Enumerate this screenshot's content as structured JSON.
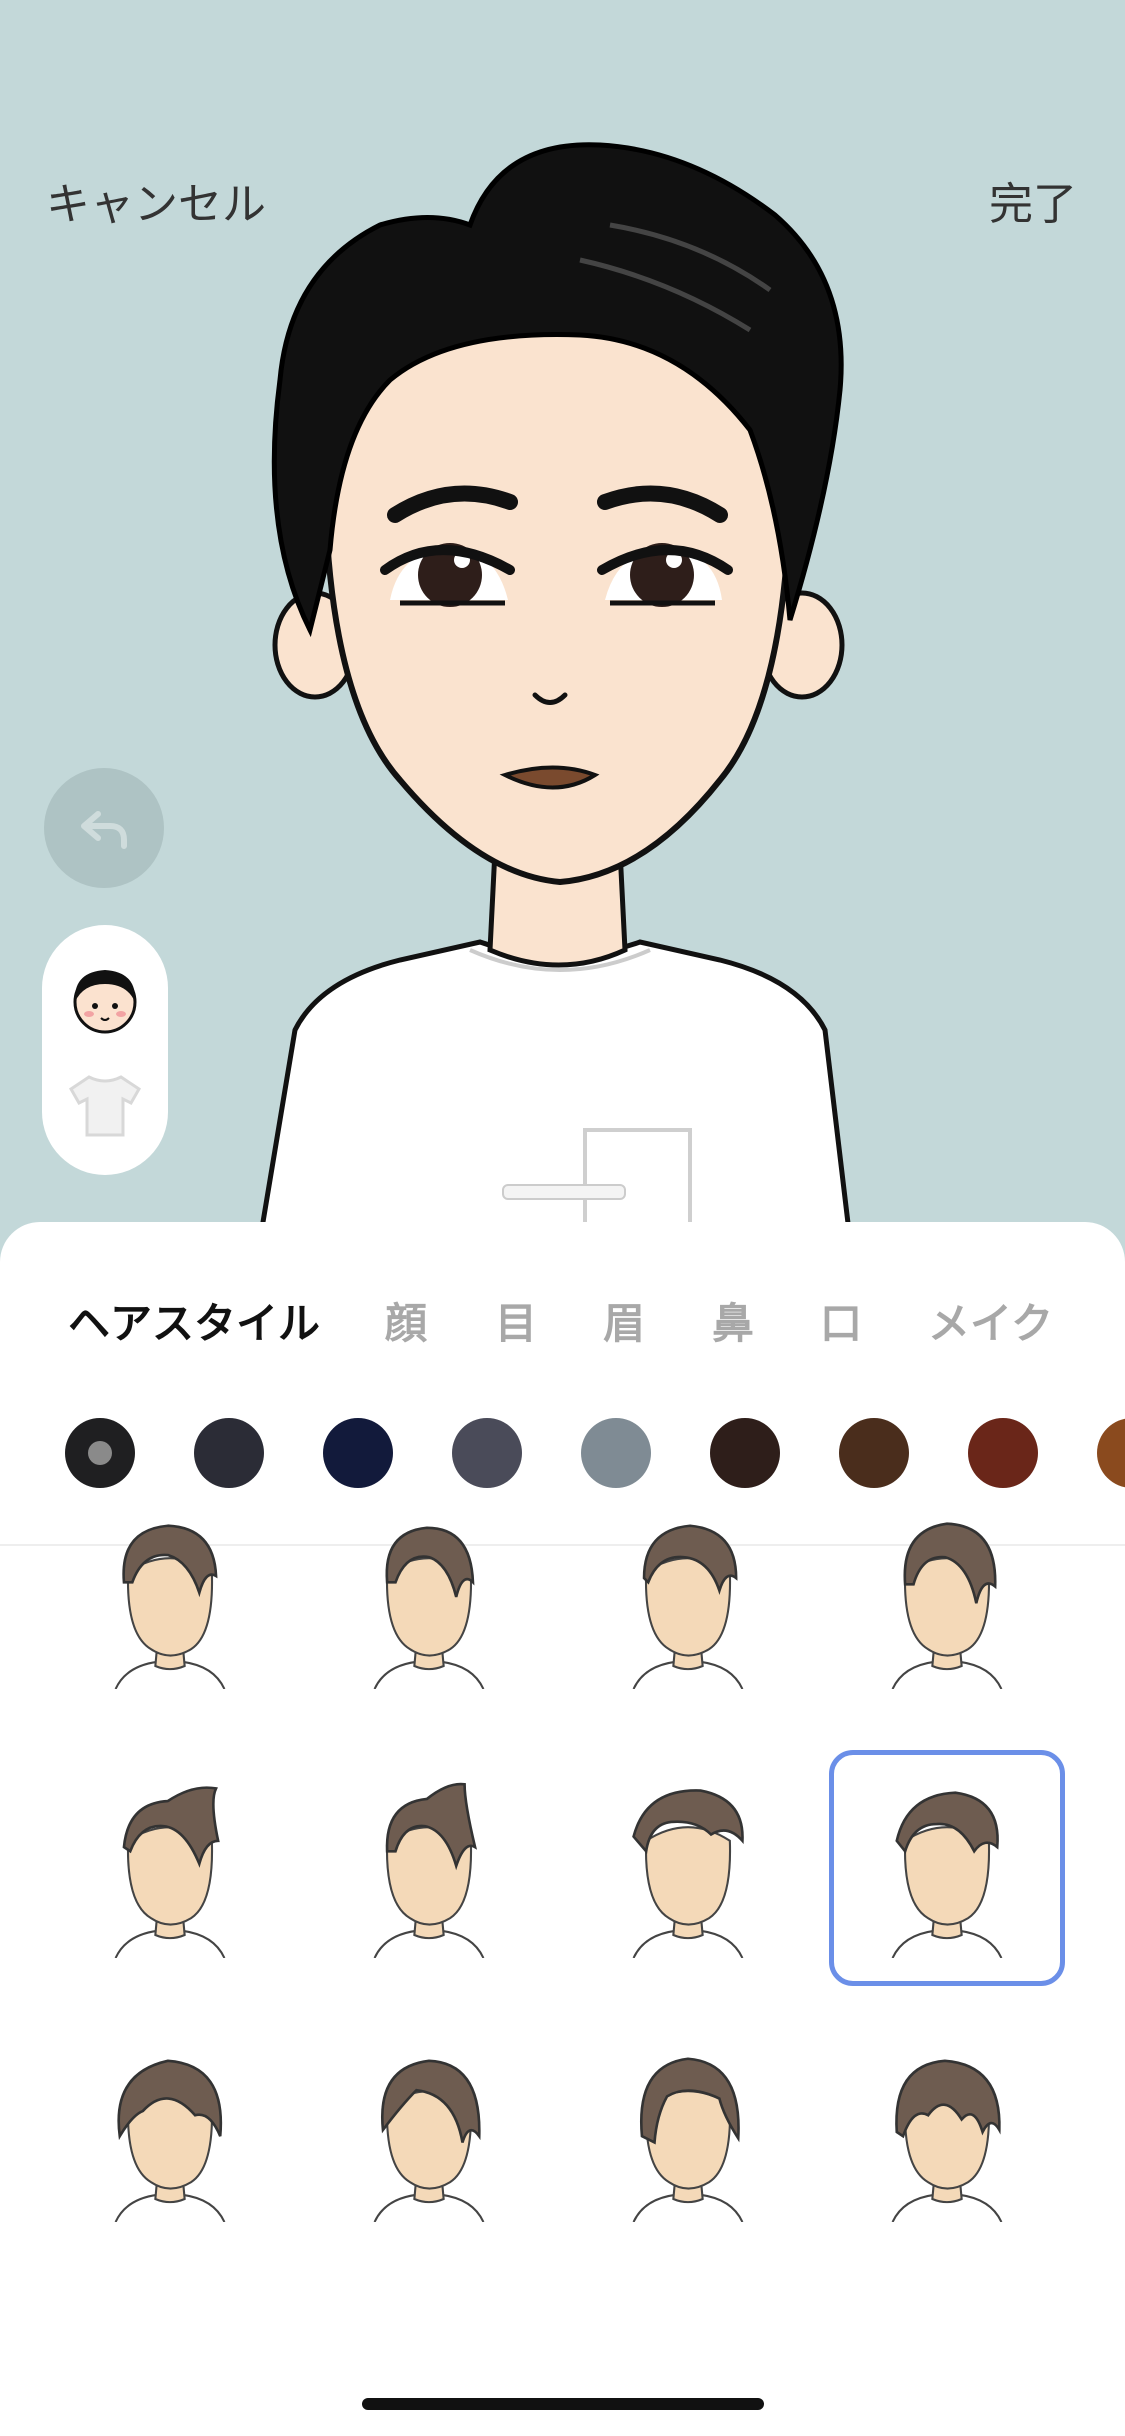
{
  "header": {
    "cancel_label": "キャンセル",
    "done_label": "完了"
  },
  "side_controls": {
    "undo_icon": "undo-arrow-icon",
    "categories": [
      {
        "icon": "face-icon",
        "selected": true
      },
      {
        "icon": "shirt-icon",
        "selected": false
      }
    ]
  },
  "tabs": [
    {
      "label": "ヘアスタイル",
      "active": true
    },
    {
      "label": "顔",
      "active": false
    },
    {
      "label": "目",
      "active": false
    },
    {
      "label": "眉",
      "active": false
    },
    {
      "label": "鼻",
      "active": false
    },
    {
      "label": "口",
      "active": false
    },
    {
      "label": "メイク",
      "active": false
    }
  ],
  "hair_colors": [
    {
      "color": "#1f1f21",
      "selected": true
    },
    {
      "color": "#2b2c36",
      "selected": false
    },
    {
      "color": "#121a3b",
      "selected": false
    },
    {
      "color": "#4a4b59",
      "selected": false
    },
    {
      "color": "#7f8b94",
      "selected": false
    },
    {
      "color": "#2e1e1a",
      "selected": false
    },
    {
      "color": "#4a2d1c",
      "selected": false
    },
    {
      "color": "#6a2619",
      "selected": false
    },
    {
      "color": "#8a4a1e",
      "selected": false
    }
  ],
  "hairstyles": [
    {
      "name": "side-part-short",
      "selected": false
    },
    {
      "name": "side-part-neat",
      "selected": false
    },
    {
      "name": "side-part-swept",
      "selected": false
    },
    {
      "name": "side-part-volume",
      "selected": false
    },
    {
      "name": "quiff-undercut",
      "selected": false
    },
    {
      "name": "quiff-tall",
      "selected": false
    },
    {
      "name": "wave-undercut",
      "selected": false
    },
    {
      "name": "wave-volume",
      "selected": true
    },
    {
      "name": "mushroom-bangs",
      "selected": false
    },
    {
      "name": "side-bangs",
      "selected": false
    },
    {
      "name": "center-part-bob",
      "selected": false
    },
    {
      "name": "choppy-bangs",
      "selected": false
    }
  ],
  "colors": {
    "background": "#c3d8d9",
    "selection_border": "#6b8fe8",
    "hair_thumb": "#6e5c50",
    "skin_thumb": "#f4d9b8",
    "avatar_hair": "#111111",
    "avatar_skin": "#fae3cf"
  }
}
